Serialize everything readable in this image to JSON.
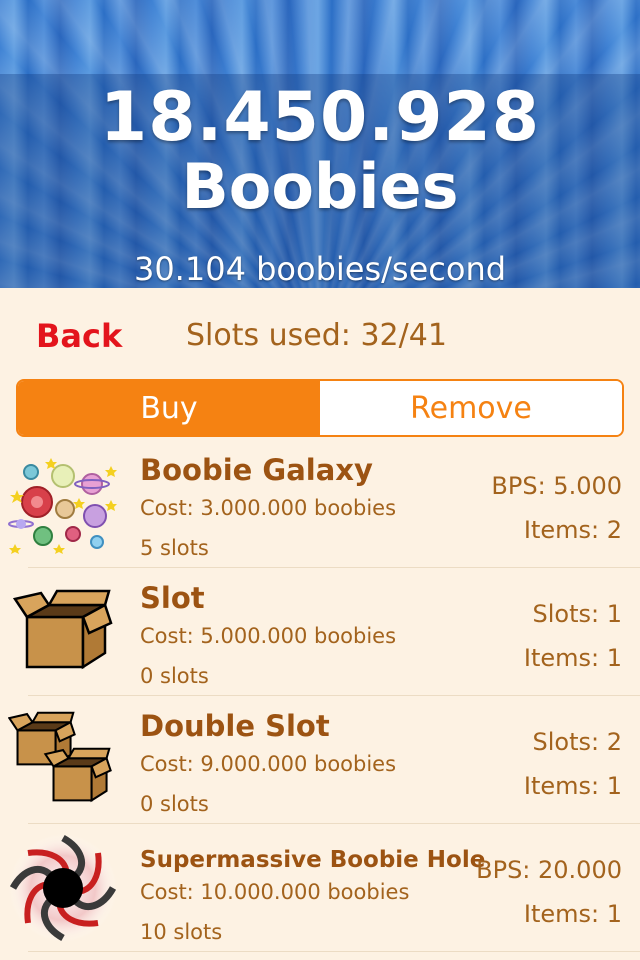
{
  "header": {
    "score": "18.450.928",
    "score_unit": "Boobies",
    "rate": "30.104 boobies/second"
  },
  "toolbar": {
    "back_label": "Back",
    "slots_used": "Slots used: 32/41"
  },
  "tabs": [
    {
      "label": "Buy",
      "selected": true
    },
    {
      "label": "Remove",
      "selected": false
    }
  ],
  "items": [
    {
      "icon": "galaxy-icon",
      "name": "Boobie Galaxy",
      "cost": "Cost: 3.000.000 boobies",
      "slots": "5 slots",
      "stat1": "BPS: 5.000",
      "stat2": "Items: 2"
    },
    {
      "icon": "box-icon",
      "name": "Slot",
      "cost": "Cost: 5.000.000 boobies",
      "slots": "0 slots",
      "stat1": "Slots: 1",
      "stat2": "Items: 1"
    },
    {
      "icon": "double-box-icon",
      "name": "Double Slot",
      "cost": "Cost: 9.000.000 boobies",
      "slots": "0 slots",
      "stat1": "Slots: 2",
      "stat2": "Items: 1"
    },
    {
      "icon": "black-hole-icon",
      "name": "Supermassive Boobie Hole",
      "cost": "Cost: 10.000.000 boobies",
      "slots": "10 slots",
      "stat1": "BPS: 20.000",
      "stat2": "Items: 1"
    }
  ],
  "colors": {
    "accent": "#f58212",
    "back": "#e3141c",
    "text": "#a3631d",
    "title": "#9c5312",
    "background": "#fdf2e3",
    "header_blue": "#3f82d4"
  }
}
